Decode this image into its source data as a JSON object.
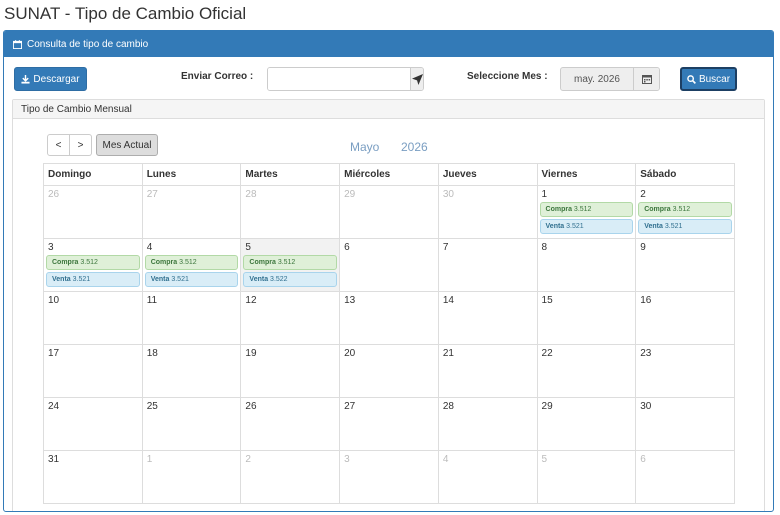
{
  "page": {
    "title": "SUNAT - Tipo de Cambio Oficial"
  },
  "panel": {
    "heading": "Consulta de tipo de cambio"
  },
  "toolbar": {
    "download_label": "Descargar",
    "email_label": "Enviar Correo :",
    "email_value": "",
    "email_placeholder": "",
    "month_label": "Seleccione Mes :",
    "month_value": "may. 2026",
    "search_label": "Buscar"
  },
  "calendar": {
    "heading": "Tipo de Cambio Mensual",
    "prev": "<",
    "next": ">",
    "current": "Mes Actual",
    "month": "Mayo",
    "year": "2026",
    "weekdays": [
      "Domingo",
      "Lunes",
      "Martes",
      "Miércoles",
      "Jueves",
      "Viernes",
      "Sábado"
    ],
    "weeks": [
      [
        {
          "d": "26",
          "o": true
        },
        {
          "d": "27",
          "o": true
        },
        {
          "d": "28",
          "o": true
        },
        {
          "d": "29",
          "o": true
        },
        {
          "d": "30",
          "o": true
        },
        {
          "d": "1",
          "c": "Compra",
          "cv": "3.512",
          "v": "Venta",
          "vv": "3.521"
        },
        {
          "d": "2",
          "c": "Compra",
          "cv": "3.512",
          "v": "Venta",
          "vv": "3.521"
        }
      ],
      [
        {
          "d": "3",
          "c": "Compra",
          "cv": "3.512",
          "v": "Venta",
          "vv": "3.521"
        },
        {
          "d": "4",
          "c": "Compra",
          "cv": "3.512",
          "v": "Venta",
          "vv": "3.521"
        },
        {
          "d": "5",
          "c": "Compra",
          "cv": "3.512",
          "v": "Venta",
          "vv": "3.522",
          "t": true
        },
        {
          "d": "6"
        },
        {
          "d": "7"
        },
        {
          "d": "8"
        },
        {
          "d": "9"
        }
      ],
      [
        {
          "d": "10"
        },
        {
          "d": "11"
        },
        {
          "d": "12"
        },
        {
          "d": "13"
        },
        {
          "d": "14"
        },
        {
          "d": "15"
        },
        {
          "d": "16"
        }
      ],
      [
        {
          "d": "17"
        },
        {
          "d": "18"
        },
        {
          "d": "19"
        },
        {
          "d": "20"
        },
        {
          "d": "21"
        },
        {
          "d": "22"
        },
        {
          "d": "23"
        }
      ],
      [
        {
          "d": "24"
        },
        {
          "d": "25"
        },
        {
          "d": "26"
        },
        {
          "d": "27"
        },
        {
          "d": "28"
        },
        {
          "d": "29"
        },
        {
          "d": "30"
        }
      ],
      [
        {
          "d": "31"
        },
        {
          "d": "1",
          "o": true
        },
        {
          "d": "2",
          "o": true
        },
        {
          "d": "3",
          "o": true
        },
        {
          "d": "4",
          "o": true
        },
        {
          "d": "5",
          "o": true
        },
        {
          "d": "6",
          "o": true
        }
      ]
    ]
  }
}
